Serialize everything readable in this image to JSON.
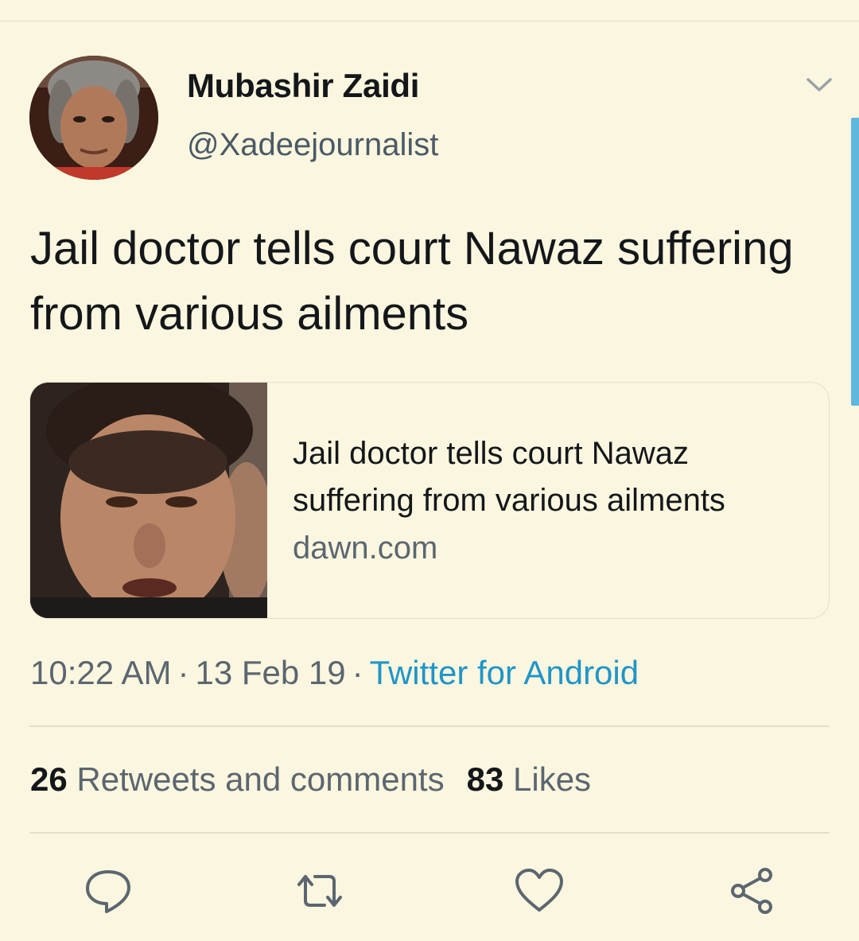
{
  "author": {
    "display_name": "Mubashir Zaidi",
    "handle": "@Xadeejournalist",
    "avatar": "profile-photo"
  },
  "tweet": {
    "text": "Jail doctor tells court Nawaz suffering from various ailments"
  },
  "link_card": {
    "title": "Jail doctor tells court Nawaz suffering from various ailments",
    "domain": "dawn.com",
    "thumbnail": "news-photo"
  },
  "meta": {
    "time": "10:22 AM",
    "separator": "·",
    "date": "13 Feb 19",
    "source": "Twitter for Android"
  },
  "stats": {
    "retweets_count": "26",
    "retweets_label": "Retweets and comments",
    "likes_count": "83",
    "likes_label": "Likes"
  },
  "actions": {
    "reply_icon": "reply-icon",
    "retweet_icon": "retweet-icon",
    "like_icon": "heart-icon",
    "share_icon": "share-icon",
    "menu_icon": "chevron-down-icon"
  },
  "colors": {
    "background": "#fbf6df",
    "accent": "#1f95c8",
    "text_primary": "#14171a",
    "text_secondary": "#5b6670"
  }
}
